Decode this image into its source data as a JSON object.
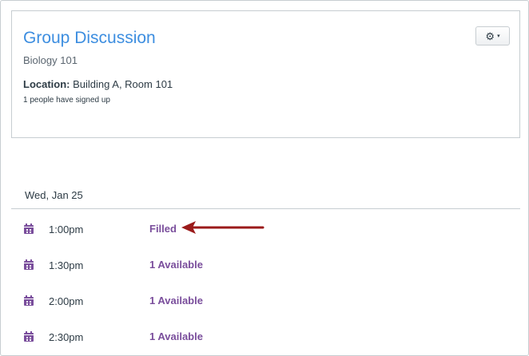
{
  "event": {
    "title": "Group Discussion",
    "course": "Biology 101",
    "location_label": "Location:",
    "location_value": "Building A, Room 101",
    "signup_text": "1 people have signed up"
  },
  "settings_button": {
    "icon": "gear-icon",
    "caret": "▾"
  },
  "schedule": {
    "date": "Wed, Jan 25",
    "slots": [
      {
        "time": "1:00pm",
        "status": "Filled"
      },
      {
        "time": "1:30pm",
        "status": "1 Available"
      },
      {
        "time": "2:00pm",
        "status": "1 Available"
      },
      {
        "time": "2:30pm",
        "status": "1 Available"
      }
    ]
  },
  "colors": {
    "title_link": "#3d8ee0",
    "status_link": "#7a4e9c",
    "calendar_icon": "#7a4e9c",
    "annotation_arrow": "#9b1b1b"
  }
}
